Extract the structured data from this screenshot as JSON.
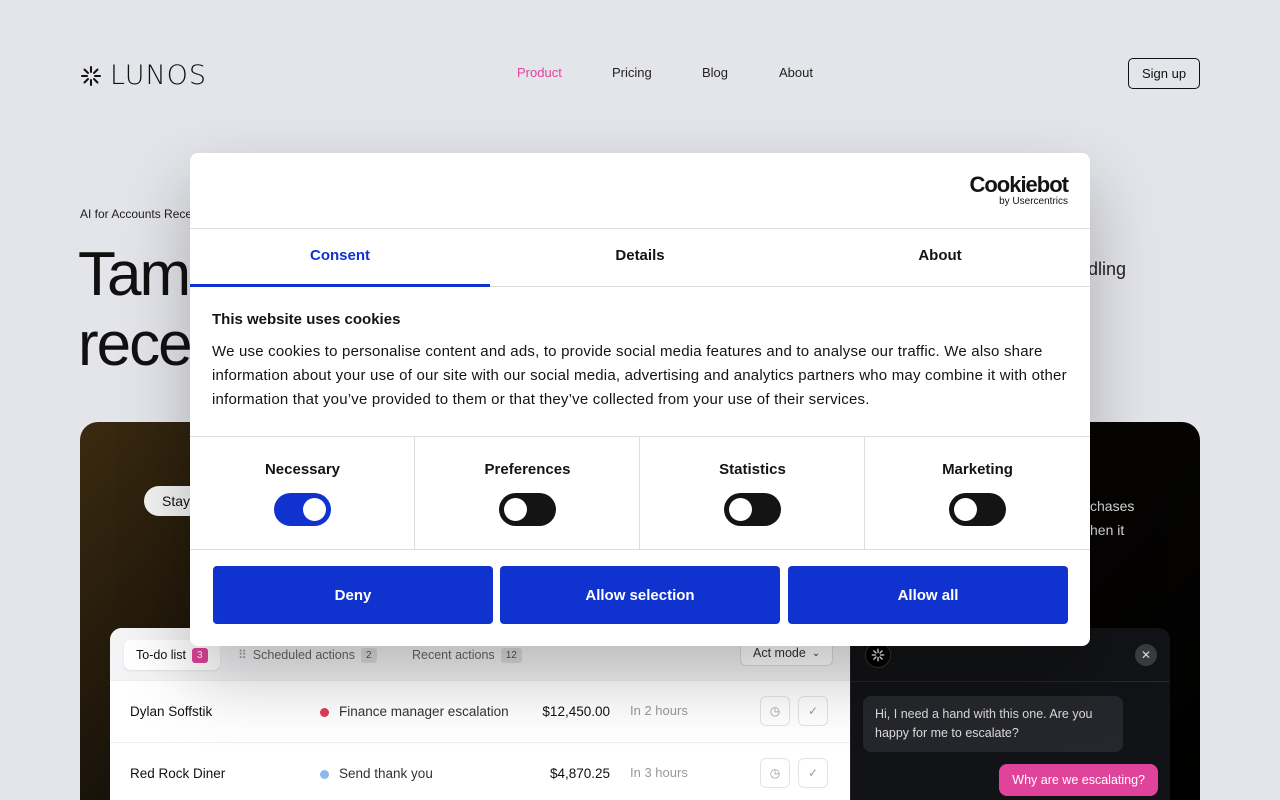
{
  "nav": {
    "logo_text": "LUNOS",
    "links": [
      {
        "label": "Product",
        "active": true
      },
      {
        "label": "Pricing",
        "active": false
      },
      {
        "label": "Blog",
        "active": false
      },
      {
        "label": "About",
        "active": false
      }
    ],
    "signup_label": "Sign up"
  },
  "hero": {
    "eyebrow": "AI for Accounts Rece",
    "title_line1": "Tame",
    "title_line2": "rece",
    "side_text": "dling"
  },
  "panel": {
    "pill": "Stay",
    "side_line1": "chases",
    "side_line2": "hen it"
  },
  "todo": {
    "tabs": [
      {
        "label": "To-do list",
        "badge": "3"
      },
      {
        "label": "Scheduled actions",
        "badge": "2"
      },
      {
        "label": "Recent actions",
        "badge": "12"
      }
    ],
    "mode_label": "Act mode",
    "rows": [
      {
        "name": "Dylan Soffstik",
        "task": "Finance manager escalation",
        "task_color": "#e23b52",
        "amount": "$12,450.00",
        "when": "In 2 hours"
      },
      {
        "name": "Red Rock Diner",
        "task": "Send thank you",
        "task_color": "#8fb7ef",
        "amount": "$4,870.25",
        "when": "In 3 hours"
      }
    ]
  },
  "chat": {
    "incoming": "Hi, I need a hand with this one. Are you happy for me to escalate?",
    "outgoing": "Why are we escalating?"
  },
  "cookie": {
    "brand": "Cookiebot",
    "brand_sub": "by Usercentrics",
    "tabs": [
      "Consent",
      "Details",
      "About"
    ],
    "heading": "This website uses cookies",
    "body": "We use cookies to personalise content and ads, to provide social media features and to analyse our traffic. We also share information about your use of our site with our social media, advertising and analytics partners who may combine it with other information that you’ve provided to them or that they’ve collected from your use of their services.",
    "toggles": [
      {
        "label": "Necessary",
        "on": true
      },
      {
        "label": "Preferences",
        "on": false
      },
      {
        "label": "Statistics",
        "on": false
      },
      {
        "label": "Marketing",
        "on": false
      }
    ],
    "buttons": {
      "deny": "Deny",
      "selection": "Allow selection",
      "all": "Allow all"
    },
    "accent": "#1032cf"
  }
}
